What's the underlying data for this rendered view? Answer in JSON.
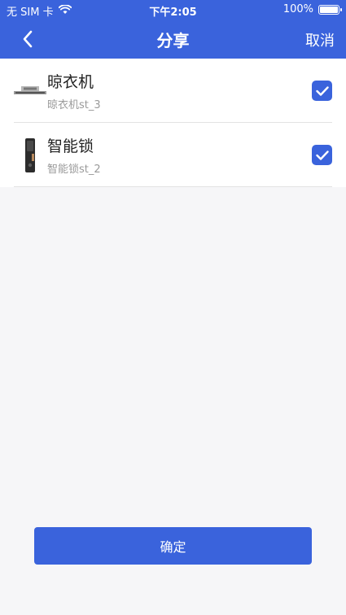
{
  "status_bar": {
    "carrier": "无 SIM 卡",
    "time": "下午2:05",
    "battery": "100%"
  },
  "nav": {
    "title": "分享",
    "cancel_label": "取消"
  },
  "devices": [
    {
      "name": "晾衣机",
      "id_label": "晾衣机st_3",
      "checked": true,
      "icon": "clothes-dryer-icon"
    },
    {
      "name": "智能锁",
      "id_label": "智能锁st_2",
      "checked": true,
      "icon": "smart-lock-icon"
    }
  ],
  "confirm_label": "确定",
  "colors": {
    "primary": "#3a63dc",
    "background": "#f6f6f8",
    "text": "#222222",
    "subtext": "#9a9a9a"
  }
}
